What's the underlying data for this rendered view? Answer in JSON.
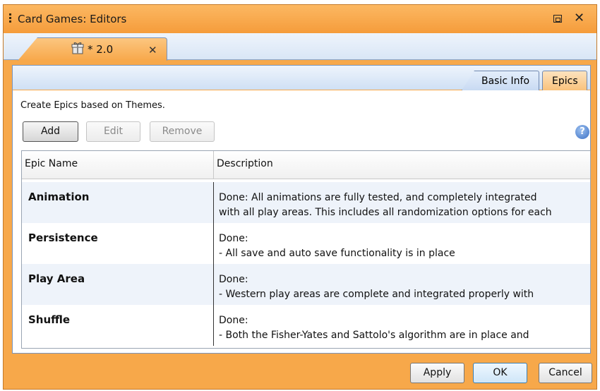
{
  "window": {
    "title": "Card Games: Editors"
  },
  "doc_tab": {
    "label": "* 2.0",
    "icon": "gift-box-icon"
  },
  "subtabs": [
    {
      "label": "Basic Info"
    },
    {
      "label": "Epics",
      "selected": true
    }
  ],
  "instruction": "Create Epics based on Themes.",
  "toolbar": {
    "add_label": "Add",
    "edit_label": "Edit",
    "remove_label": "Remove"
  },
  "table": {
    "columns": [
      "Epic Name",
      "Description"
    ],
    "rows": [
      {
        "name": "Animation",
        "description": "Done: All animations are fully tested, and completely integrated\nwith all play areas. This includes all randomization options for each"
      },
      {
        "name": "Persistence",
        "description": "Done:\n- All save and auto save functionality is in place"
      },
      {
        "name": "Play Area",
        "description": "Done:\n- Western play areas are complete and integrated properly with"
      },
      {
        "name": "Shuffle",
        "description": "Done:\n- Both the Fisher-Yates and Sattolo's algorithm are in place and"
      }
    ]
  },
  "footer": {
    "apply_label": "Apply",
    "ok_label": "OK",
    "cancel_label": "Cancel"
  },
  "colors": {
    "frame": "#f7a84a",
    "accent_blue": "#7a94bc"
  }
}
